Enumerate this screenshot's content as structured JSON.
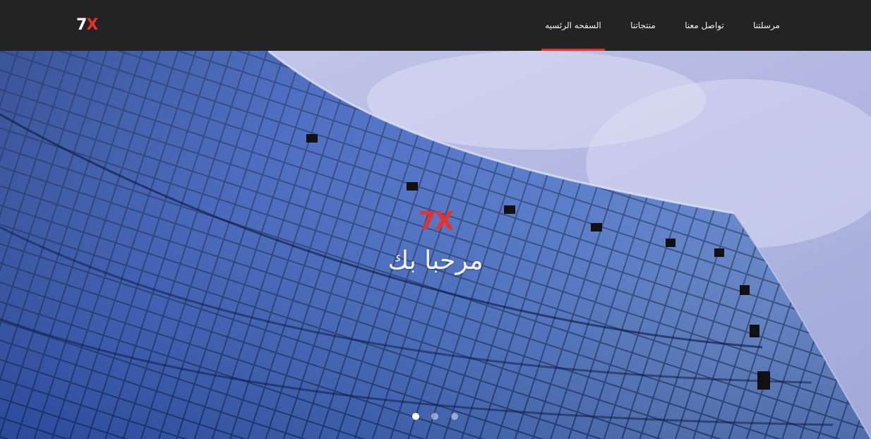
{
  "header": {
    "logo": {
      "digit": "7",
      "letter": "X"
    },
    "nav": [
      {
        "label": "مرسلتنا",
        "active": false
      },
      {
        "label": "تواصل معنا",
        "active": false
      },
      {
        "label": "منتجاتنا",
        "active": false
      },
      {
        "label": "السفحه الرئسيه",
        "active": true
      }
    ]
  },
  "hero": {
    "logo": {
      "digit": "7",
      "letter": "X"
    },
    "subtitle": "مرحبا بك",
    "slides": {
      "count": 3,
      "active_index": 0
    }
  },
  "colors": {
    "navbar": "#232323",
    "accent": "#e8312a",
    "nav_text": "#f2f2f2"
  }
}
